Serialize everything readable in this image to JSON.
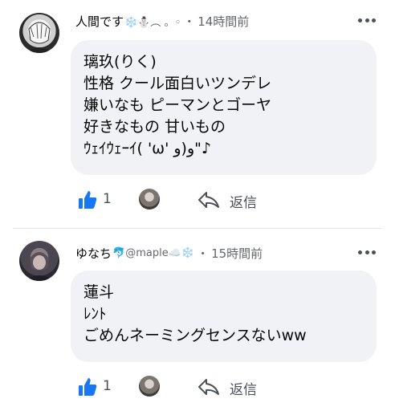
{
  "colors": {
    "bubble_bg": "#f0f2f5",
    "meta_text": "#65676b",
    "like_blue": "#1877f2",
    "divider": "#e4e6eb"
  },
  "comments": [
    {
      "author": "人間です",
      "author_emojis": "❄️⛄️︵ 。◦",
      "separator": "・",
      "time": "14時間前",
      "lines": [
        "璃玖(りく)",
        "性格 クール面白いツンデレ",
        "嫌いなも ピーマンとゴーヤ",
        "好きなもの 甘いもの",
        "ｳｪｲｳｪｰｲ( 'ω' و)و\"♪"
      ],
      "like_count": "1",
      "reply_label": "返信",
      "icons": {
        "like": "thumbs-up-icon",
        "reply": "reply-arrow-icon",
        "more": "more-dots-icon"
      }
    },
    {
      "author": "ゆなち",
      "author_emojis": "🐬@maple☁️❄️",
      "separator": "・",
      "time": "15時間前",
      "lines": [
        "蓮斗",
        "ﾚﾝﾄ",
        "ごめんネーミングセンスないww"
      ],
      "like_count": "1",
      "reply_label": "返信",
      "icons": {
        "like": "thumbs-up-icon",
        "reply": "reply-arrow-icon",
        "more": "more-dots-icon"
      }
    }
  ]
}
